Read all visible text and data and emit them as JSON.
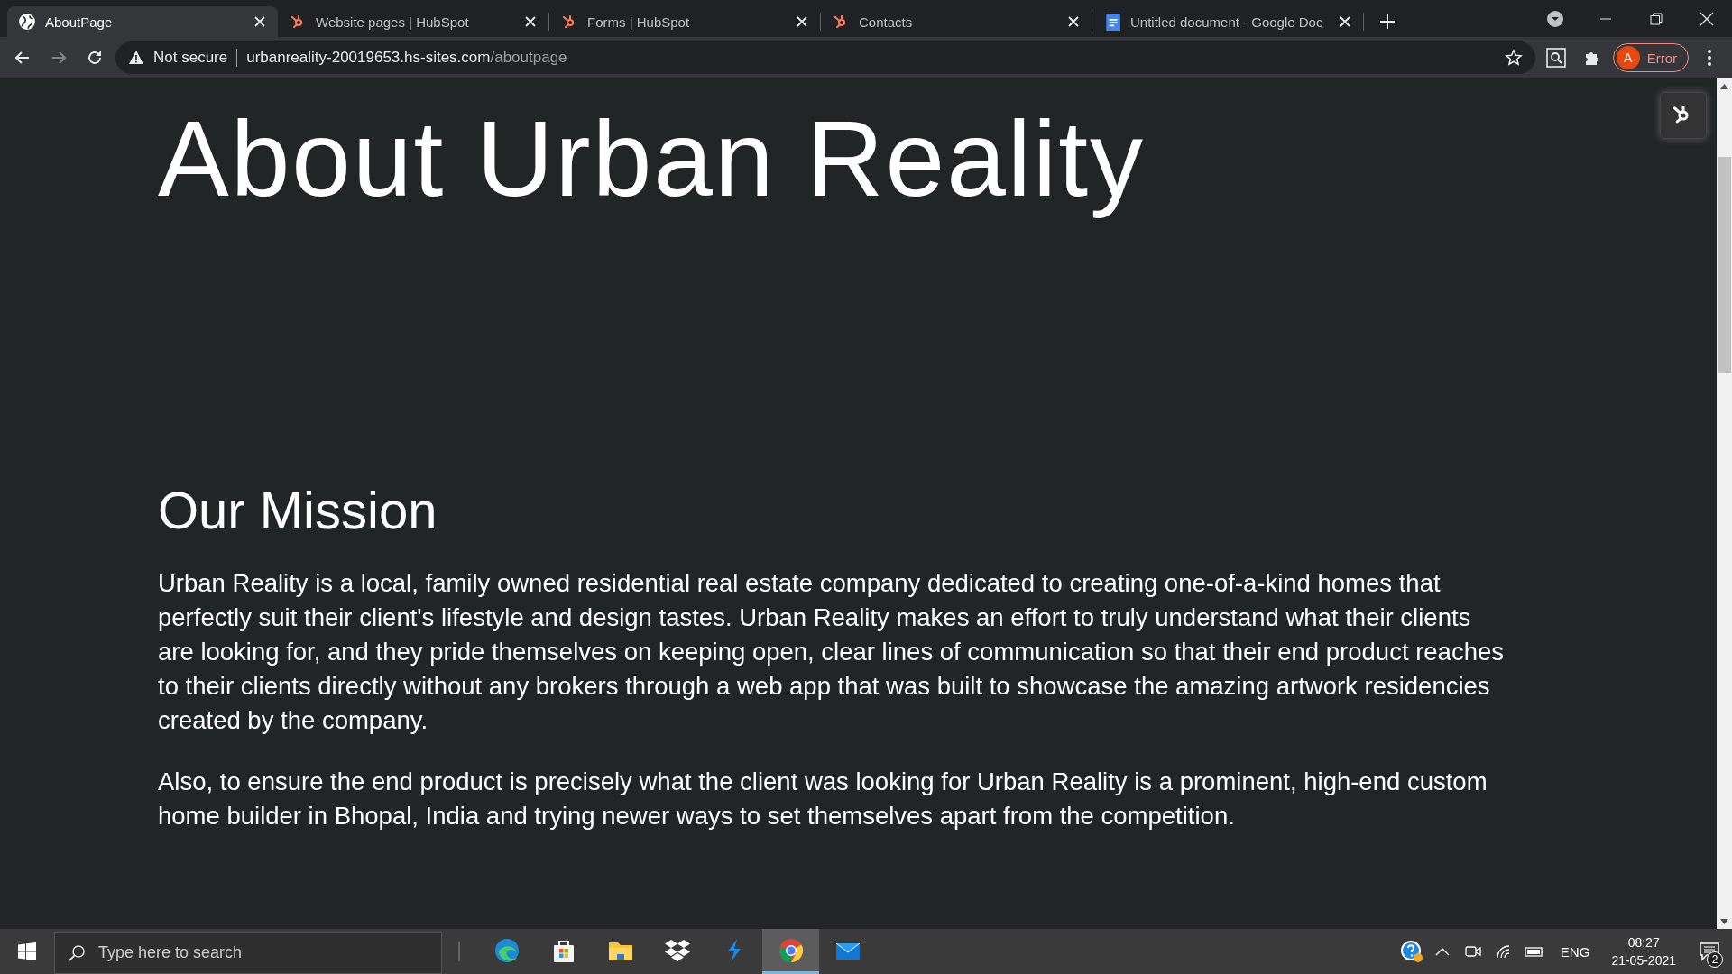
{
  "tabs": [
    {
      "title": "AboutPage",
      "kind": "globe",
      "selected": true
    },
    {
      "title": "Website pages | HubSpot",
      "kind": "hubspot",
      "selected": false
    },
    {
      "title": "Forms | HubSpot",
      "kind": "hubspot",
      "selected": false
    },
    {
      "title": "Contacts",
      "kind": "hubspot",
      "selected": false
    },
    {
      "title": "Untitled document - Google Doc",
      "kind": "doc",
      "selected": false
    }
  ],
  "address_bar": {
    "security": "Not secure",
    "host": "urbanreality-20019653.hs-sites.com",
    "path": "/aboutpage"
  },
  "profile": {
    "initial": "A",
    "status": "Error"
  },
  "page": {
    "title": "About Urban Reality",
    "section_heading": "Our Mission",
    "paragraphs": [
      "Urban Reality is a local, family owned residential real estate company dedicated to creating one-of-a-kind homes that perfectly suit their client's lifestyle and design tastes. Urban Reality makes an effort to truly understand what their clients are looking for, and they pride themselves on keeping open, clear lines of communication so that their end product reaches to their clients directly without any brokers through a web app that was built to showcase the amazing artwork residencies created by the company.",
      "Also, to ensure the end product is precisely what the client was looking for Urban Reality is a prominent, high-end custom home builder in Bhopal, India and trying newer ways to set themselves apart from the competition."
    ]
  },
  "taskbar": {
    "search_placeholder": "Type here to search",
    "apps": [
      {
        "kind": "edge",
        "selected": false
      },
      {
        "kind": "store",
        "selected": false
      },
      {
        "kind": "folder",
        "selected": false
      },
      {
        "kind": "dropbox",
        "selected": false
      },
      {
        "kind": "bolt",
        "selected": false
      },
      {
        "kind": "chrome",
        "selected": true
      },
      {
        "kind": "mail",
        "selected": false
      }
    ],
    "language": "ENG",
    "time": "08:27",
    "date": "21-05-2021",
    "notification_count": "2"
  }
}
